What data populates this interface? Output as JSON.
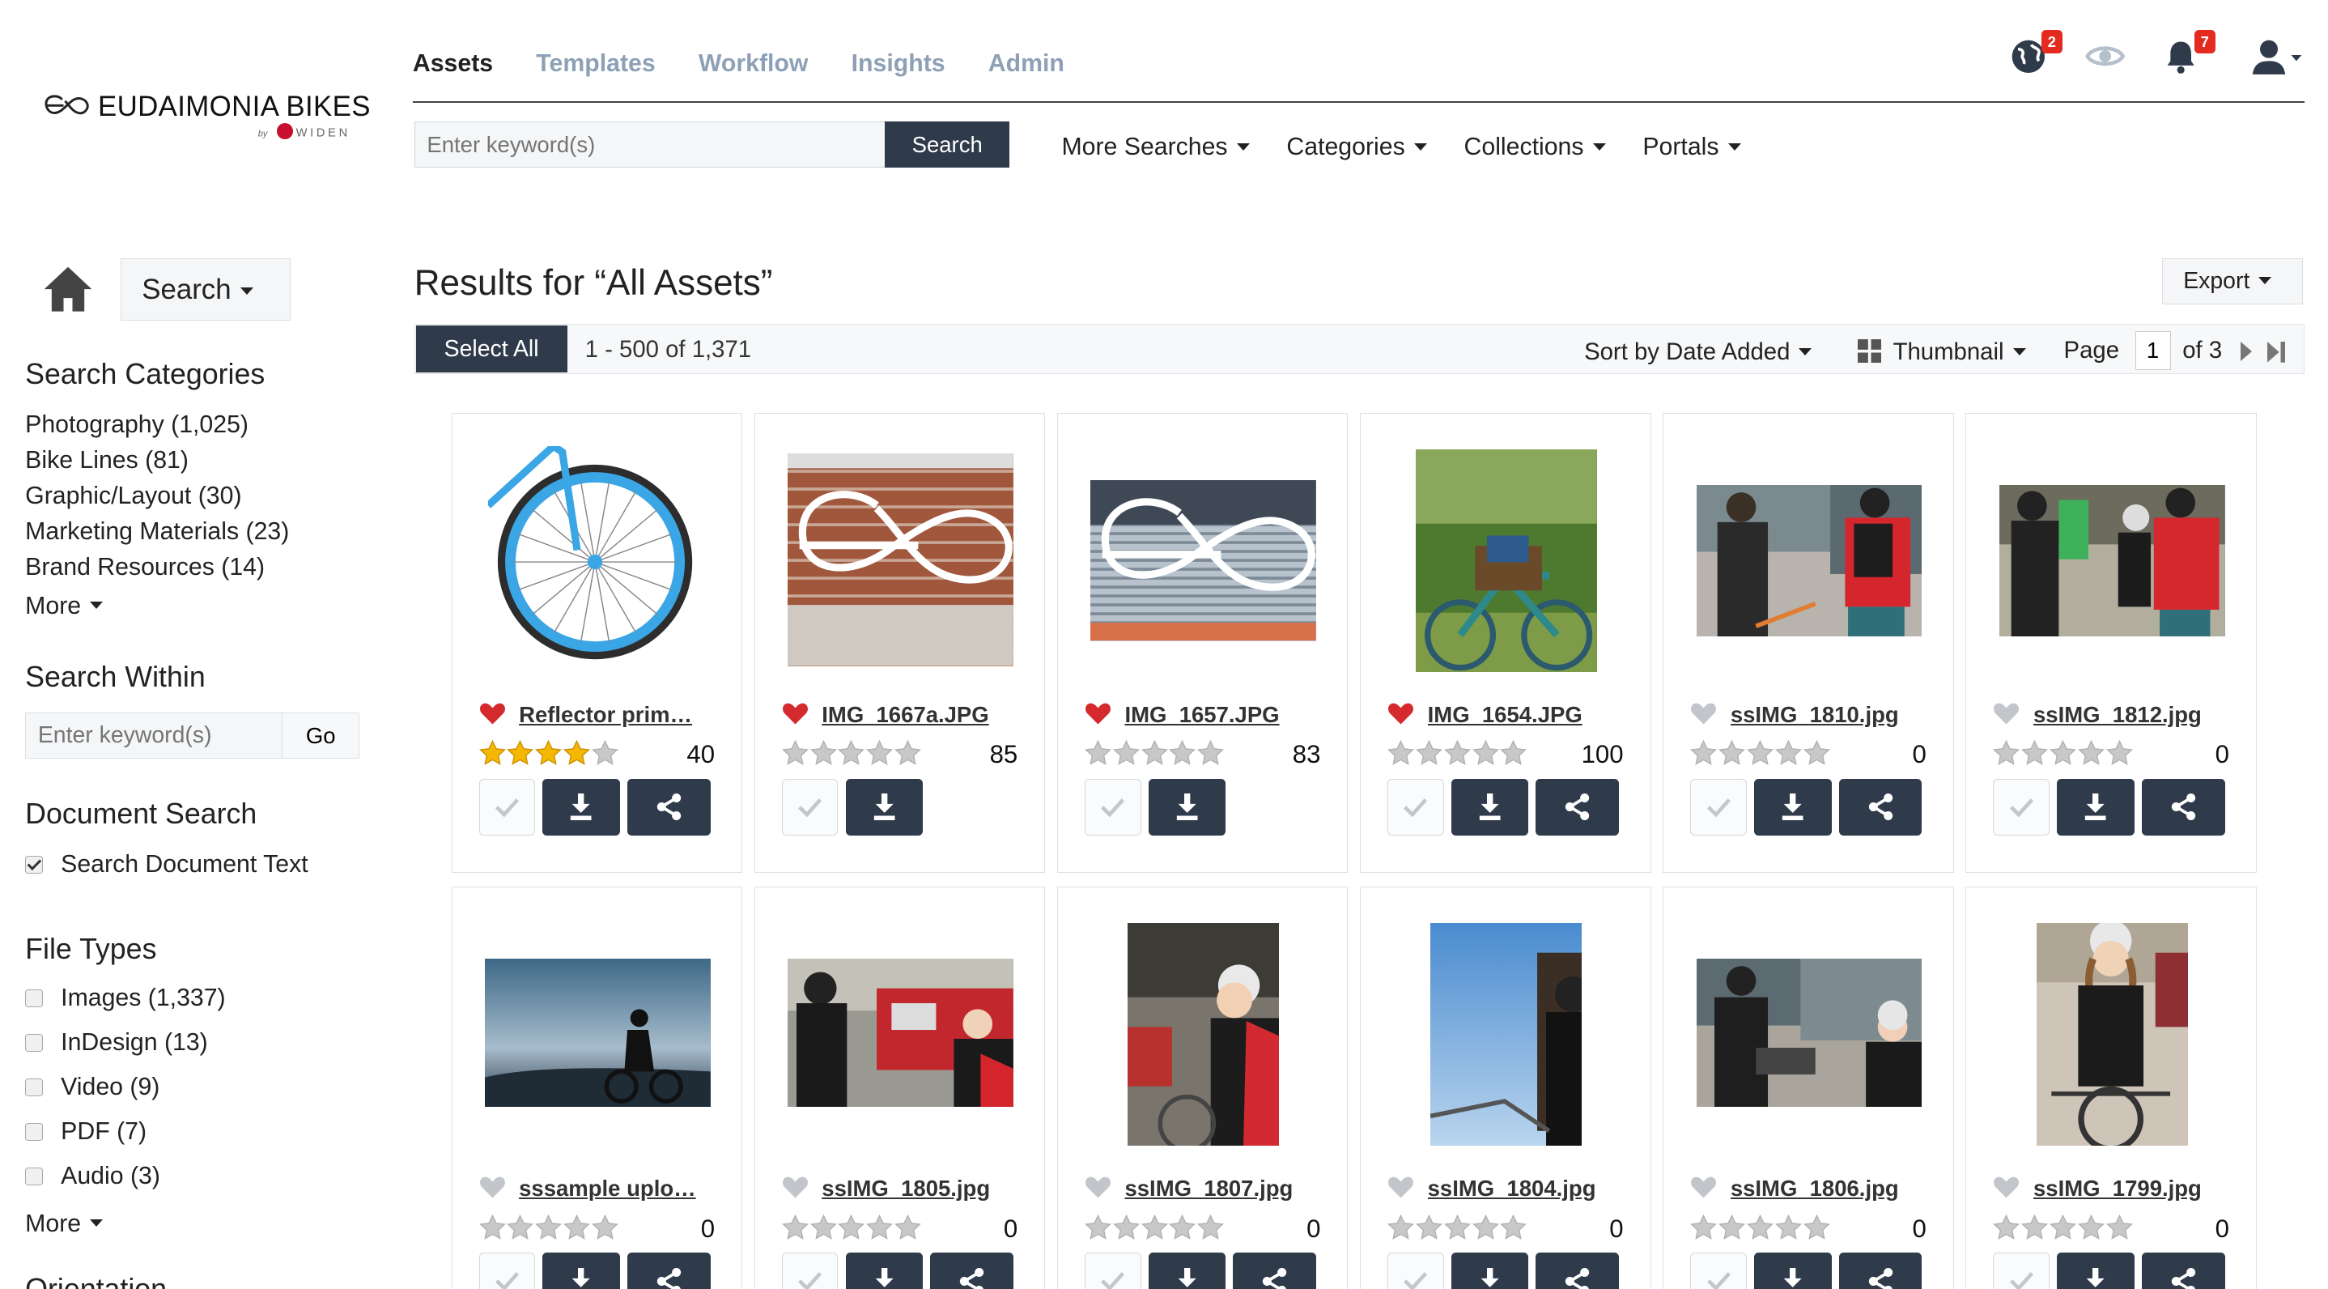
{
  "brand": {
    "name": "EUDAIMONIA BIKES",
    "by": "by",
    "vendor": "WIDEN"
  },
  "topnav": [
    {
      "label": "Assets",
      "active": true
    },
    {
      "label": "Templates"
    },
    {
      "label": "Workflow"
    },
    {
      "label": "Insights"
    },
    {
      "label": "Admin"
    }
  ],
  "topicons": {
    "globe_badge": "2",
    "bell_badge": "7"
  },
  "search": {
    "placeholder": "Enter keyword(s)",
    "button": "Search"
  },
  "subnav": [
    "More Searches",
    "Categories",
    "Collections",
    "Portals"
  ],
  "sidebar": {
    "search_dropdown": "Search",
    "categories_title": "Search Categories",
    "categories": [
      "Photography (1,025)",
      "Bike Lines (81)",
      "Graphic/Layout (30)",
      "Marketing Materials (23)",
      "Brand Resources (14)"
    ],
    "categories_more": "More",
    "within_title": "Search Within",
    "within_placeholder": "Enter keyword(s)",
    "within_go": "Go",
    "doc_title": "Document Search",
    "doc_option": "Search Document Text",
    "filetypes_title": "File Types",
    "filetypes": [
      "Images (1,337)",
      "InDesign (13)",
      "Video (9)",
      "PDF (7)",
      "Audio (3)"
    ],
    "filetypes_more": "More",
    "orientation_title": "Orientation"
  },
  "results": {
    "title": "Results for “All Assets”",
    "export": "Export",
    "select_all": "Select All",
    "count": "1 - 500 of 1,371",
    "sort": "Sort by Date Added",
    "view": "Thumbnail",
    "page_label": "Page",
    "page": "1",
    "of_pages": "of 3"
  },
  "assets": [
    {
      "name": "Reflector prim…",
      "fav": true,
      "rating": 4,
      "views": "40",
      "share": true,
      "thumb": "wheel"
    },
    {
      "name": "IMG_1667a.JPG",
      "fav": true,
      "rating": 0,
      "views": "85",
      "share": false,
      "thumb": "logo-brick"
    },
    {
      "name": "IMG_1657.JPG",
      "fav": true,
      "rating": 0,
      "views": "83",
      "share": false,
      "thumb": "logo-shutter"
    },
    {
      "name": "IMG_1654.JPG",
      "fav": true,
      "rating": 0,
      "views": "100",
      "share": true,
      "thumb": "bike-basket"
    },
    {
      "name": "ssIMG_1810.jpg",
      "fav": false,
      "rating": 0,
      "views": "0",
      "share": true,
      "thumb": "riders-street"
    },
    {
      "name": "ssIMG_1812.jpg",
      "fav": false,
      "rating": 0,
      "views": "0",
      "share": true,
      "thumb": "riders-street2"
    },
    {
      "name": "sssample uplo…",
      "fav": false,
      "rating": 0,
      "views": "0",
      "share": true,
      "thumb": "silhouette"
    },
    {
      "name": "ssIMG_1805.jpg",
      "fav": false,
      "rating": 0,
      "views": "0",
      "share": true,
      "thumb": "riders-truck"
    },
    {
      "name": "ssIMG_1807.jpg",
      "fav": false,
      "rating": 0,
      "views": "0",
      "share": true,
      "thumb": "rider-portrait"
    },
    {
      "name": "ssIMG_1804.jpg",
      "fav": false,
      "rating": 0,
      "views": "0",
      "share": true,
      "thumb": "rider-sky"
    },
    {
      "name": "ssIMG_1806.jpg",
      "fav": false,
      "rating": 0,
      "views": "0",
      "share": true,
      "thumb": "riders-street3"
    },
    {
      "name": "ssIMG_1799.jpg",
      "fav": false,
      "rating": 0,
      "views": "0",
      "share": true,
      "thumb": "woman-bike"
    }
  ]
}
